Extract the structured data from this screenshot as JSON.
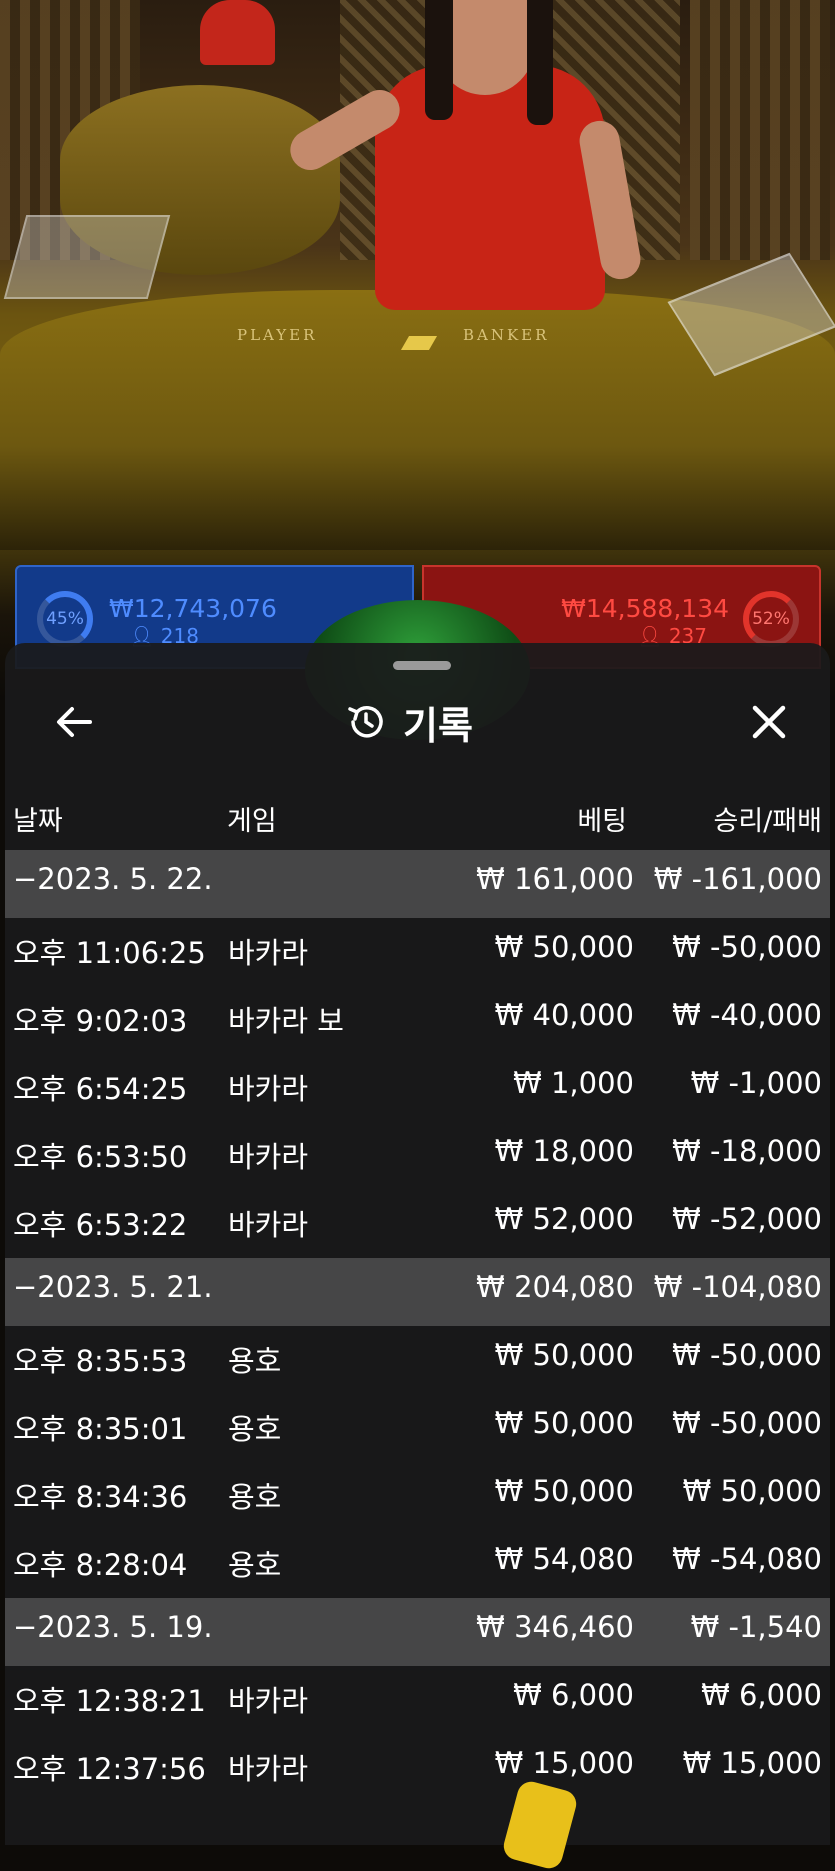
{
  "table": {
    "player_label": "PLAYER",
    "banker_label": "BANKER"
  },
  "bets": {
    "player": {
      "percent": "45%",
      "amount": "₩12,743,076",
      "count": "218"
    },
    "banker": {
      "percent": "52%",
      "amount": "₩14,588,134",
      "count": "237"
    }
  },
  "history": {
    "title": "기록",
    "icons": {
      "back": "arrow-left-icon",
      "history": "history-icon",
      "close": "close-icon"
    },
    "columns": {
      "date": "날짜",
      "game": "게임",
      "bet": "베팅",
      "result": "승리/패배"
    },
    "rows": [
      {
        "type": "date",
        "date": "−2023. 5. 22.",
        "bet": "₩ 161,000",
        "result": "₩ -161,000"
      },
      {
        "type": "entry",
        "time": "오후 11:06:25",
        "game": "바카라",
        "bet": "₩ 50,000",
        "result": "₩ -50,000"
      },
      {
        "type": "entry",
        "time": "오후 9:02:03",
        "game": "바카라 보",
        "bet": "₩ 40,000",
        "result": "₩ -40,000"
      },
      {
        "type": "entry",
        "time": "오후 6:54:25",
        "game": "바카라",
        "bet": "₩ 1,000",
        "result": "₩ -1,000"
      },
      {
        "type": "entry",
        "time": "오후 6:53:50",
        "game": "바카라",
        "bet": "₩ 18,000",
        "result": "₩ -18,000"
      },
      {
        "type": "entry",
        "time": "오후 6:53:22",
        "game": "바카라",
        "bet": "₩ 52,000",
        "result": "₩ -52,000"
      },
      {
        "type": "date",
        "date": "−2023. 5. 21.",
        "bet": "₩ 204,080",
        "result": "₩ -104,080"
      },
      {
        "type": "entry",
        "time": "오후 8:35:53",
        "game": "용호",
        "bet": "₩ 50,000",
        "result": "₩ -50,000"
      },
      {
        "type": "entry",
        "time": "오후 8:35:01",
        "game": "용호",
        "bet": "₩ 50,000",
        "result": "₩ -50,000"
      },
      {
        "type": "entry",
        "time": "오후 8:34:36",
        "game": "용호",
        "bet": "₩ 50,000",
        "result": "₩ 50,000"
      },
      {
        "type": "entry",
        "time": "오후 8:28:04",
        "game": "용호",
        "bet": "₩ 54,080",
        "result": "₩ -54,080"
      },
      {
        "type": "date",
        "date": "−2023. 5. 19.",
        "bet": "₩ 346,460",
        "result": "₩ -1,540"
      },
      {
        "type": "entry",
        "time": "오후 12:38:21",
        "game": "바카라",
        "bet": "₩ 6,000",
        "result": "₩ 6,000"
      },
      {
        "type": "entry",
        "time": "오후 12:37:56",
        "game": "바카라",
        "bet": "₩ 15,000",
        "result": "₩ 15,000"
      }
    ]
  },
  "colors": {
    "player": "#2f64c9",
    "banker": "#c8342c",
    "sheet": "#1a1a1b"
  }
}
